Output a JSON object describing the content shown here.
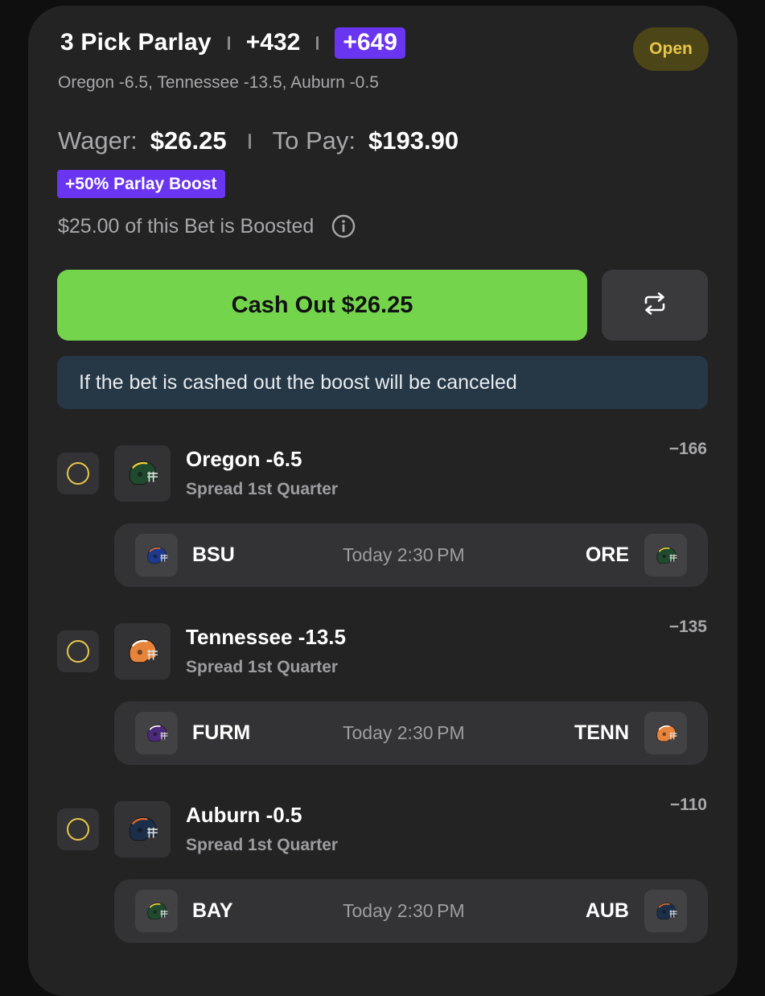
{
  "bet": {
    "title": "3 Pick Parlay",
    "odds": "+432",
    "boosted_odds": "+649",
    "status": "Open",
    "subtitle": "Oregon -6.5, Tennessee -13.5, Auburn -0.5",
    "wager_label": "Wager:",
    "wager_value": "$26.25",
    "topay_label": "To Pay:",
    "topay_value": "$193.90",
    "boost_badge": "+50% Parlay Boost",
    "boosted_note": "$25.00 of this Bet is Boosted"
  },
  "actions": {
    "cash_out_label": "Cash Out $26.25",
    "swap_icon": "swap-arrows-icon"
  },
  "notice": "If the bet is cashed out the boost will be canceled",
  "legs": [
    {
      "pick": "Oregon -6.5",
      "market": "Spread 1st Quarter",
      "odds": "−166",
      "helmet_color": "#1f4a2e",
      "helmet_accent": "#f0d23a",
      "away": "BSU",
      "away_color": "#1e3a8c",
      "away_accent": "#e46b2b",
      "time": "Today 2:30 PM",
      "home": "ORE",
      "home_color": "#1f4a2e",
      "home_accent": "#f0d23a"
    },
    {
      "pick": "Tennessee -13.5",
      "market": "Spread 1st Quarter",
      "odds": "−135",
      "helmet_color": "#e8843a",
      "helmet_accent": "#ffffff",
      "away": "FURM",
      "away_color": "#4b2a7b",
      "away_accent": "#ffffff",
      "time": "Today 2:30 PM",
      "home": "TENN",
      "home_color": "#e8843a",
      "home_accent": "#ffffff"
    },
    {
      "pick": "Auburn -0.5",
      "market": "Spread 1st Quarter",
      "odds": "−110",
      "helmet_color": "#1c2f4a",
      "helmet_accent": "#e56a2b",
      "away": "BAY",
      "away_color": "#1f4a2e",
      "away_accent": "#f0d23a",
      "time": "Today 2:30 PM",
      "home": "AUB",
      "home_color": "#1c2f4a",
      "home_accent": "#e56a2b"
    }
  ]
}
